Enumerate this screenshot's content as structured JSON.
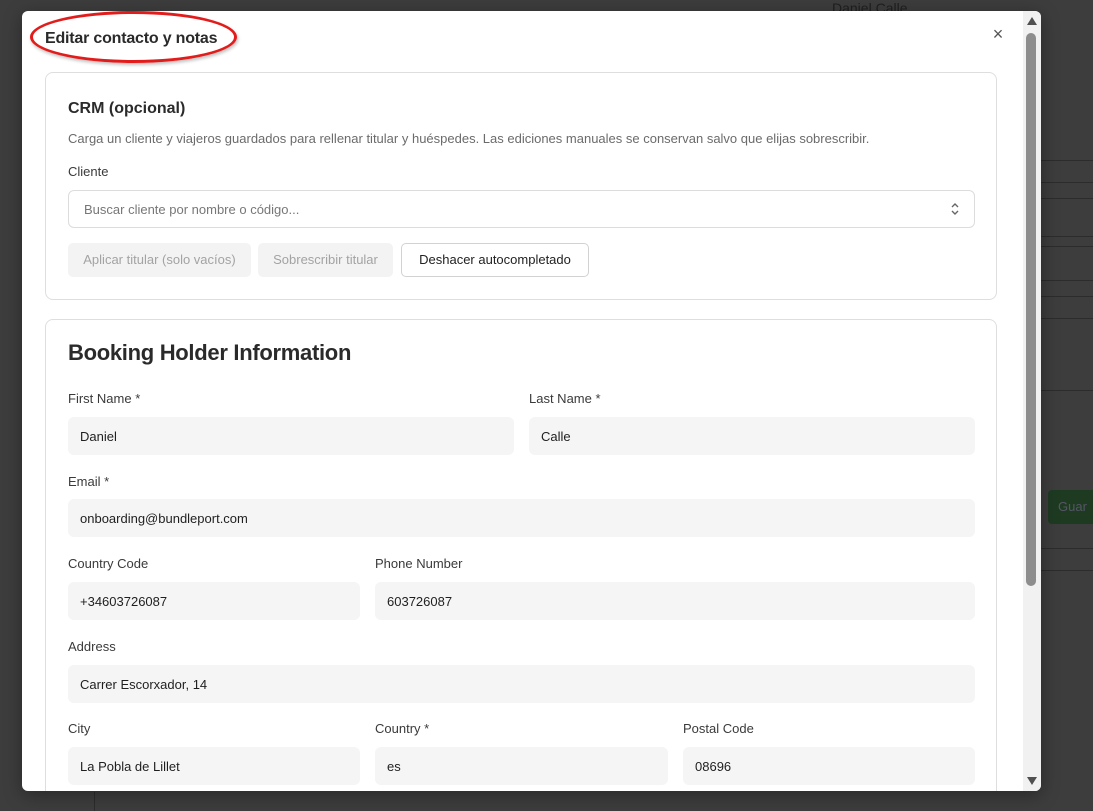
{
  "background": {
    "name_text": "Daniel Calle",
    "save_button_fragment": "Guar"
  },
  "modal": {
    "title": "Editar contacto y notas",
    "close_glyph": "×",
    "highlight_color": "#e21b1b"
  },
  "crm": {
    "title": "CRM (opcional)",
    "description": "Carga un cliente y viajeros guardados para rellenar titular y huéspedes. Las ediciones manuales se conservan salvo que elijas sobrescribir.",
    "client_label": "Cliente",
    "client_placeholder": "Buscar cliente por nombre o código...",
    "buttons": {
      "apply_holder": "Aplicar titular (solo vacíos)",
      "overwrite_holder": "Sobrescribir titular",
      "undo_autofill": "Deshacer autocompletado"
    }
  },
  "holder": {
    "title": "Booking Holder Information",
    "first_name": {
      "label": "First Name",
      "required": "*",
      "value": "Daniel"
    },
    "last_name": {
      "label": "Last Name",
      "required": "*",
      "value": "Calle"
    },
    "email": {
      "label": "Email",
      "required": "*",
      "value": "onboarding@bundleport.com"
    },
    "country_code": {
      "label": "Country Code",
      "value": "+34603726087"
    },
    "phone_number": {
      "label": "Phone Number",
      "value": "603726087"
    },
    "address": {
      "label": "Address",
      "value": "Carrer Escorxador, 14"
    },
    "city": {
      "label": "City",
      "value": "La Pobla de Lillet"
    },
    "country": {
      "label": "Country",
      "required": "*",
      "value": "es"
    },
    "postal_code": {
      "label": "Postal Code",
      "value": "08696"
    }
  }
}
